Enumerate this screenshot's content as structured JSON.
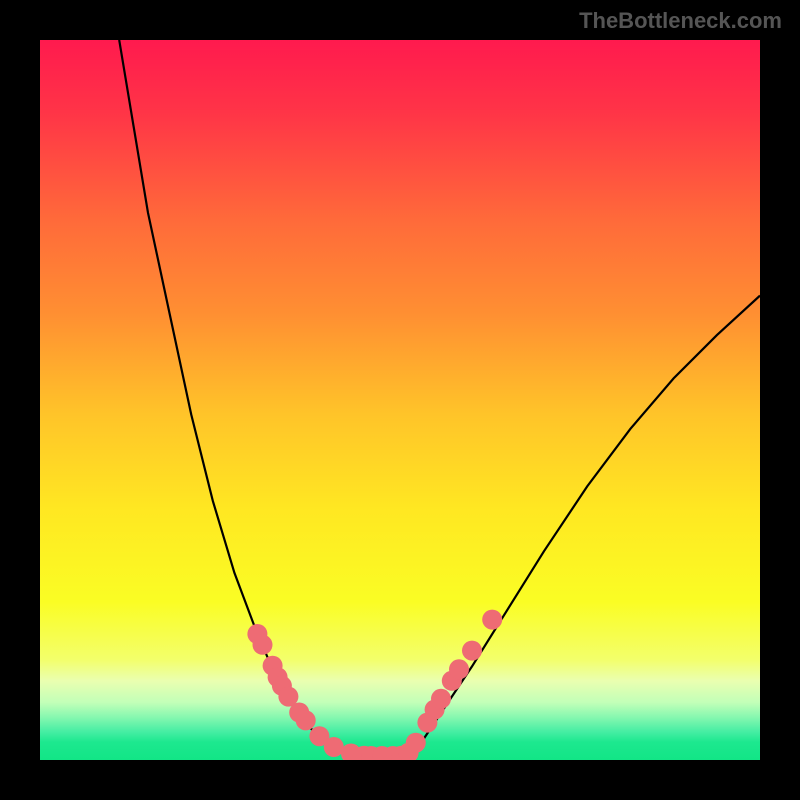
{
  "watermark": "TheBottleneck.com",
  "chart_data": {
    "type": "line",
    "title": "",
    "xlabel": "",
    "ylabel": "",
    "xlim": [
      0,
      100
    ],
    "ylim": [
      0,
      100
    ],
    "gradient_stops": [
      {
        "pos": 0.0,
        "color": "#ff1a4e"
      },
      {
        "pos": 0.1,
        "color": "#ff3447"
      },
      {
        "pos": 0.25,
        "color": "#ff6a3a"
      },
      {
        "pos": 0.38,
        "color": "#ff8f32"
      },
      {
        "pos": 0.52,
        "color": "#ffc429"
      },
      {
        "pos": 0.65,
        "color": "#ffe722"
      },
      {
        "pos": 0.78,
        "color": "#fafd24"
      },
      {
        "pos": 0.86,
        "color": "#f3ff6a"
      },
      {
        "pos": 0.89,
        "color": "#eaffb0"
      },
      {
        "pos": 0.92,
        "color": "#c2ffb8"
      },
      {
        "pos": 0.94,
        "color": "#88f8b0"
      },
      {
        "pos": 0.96,
        "color": "#48eea4"
      },
      {
        "pos": 0.975,
        "color": "#1de88f"
      },
      {
        "pos": 1.0,
        "color": "#12e586"
      }
    ],
    "curve_left": [
      {
        "x": 11.0,
        "y": 100.0
      },
      {
        "x": 13.0,
        "y": 88.0
      },
      {
        "x": 15.0,
        "y": 76.0
      },
      {
        "x": 18.0,
        "y": 62.0
      },
      {
        "x": 21.0,
        "y": 48.0
      },
      {
        "x": 24.0,
        "y": 36.0
      },
      {
        "x": 27.0,
        "y": 26.0
      },
      {
        "x": 30.0,
        "y": 18.0
      },
      {
        "x": 33.0,
        "y": 11.0
      },
      {
        "x": 36.0,
        "y": 6.0
      },
      {
        "x": 39.0,
        "y": 3.0
      },
      {
        "x": 42.0,
        "y": 1.2
      },
      {
        "x": 44.5,
        "y": 0.6
      }
    ],
    "curve_flat": [
      {
        "x": 44.5,
        "y": 0.6
      },
      {
        "x": 47.0,
        "y": 0.55
      },
      {
        "x": 49.0,
        "y": 0.55
      },
      {
        "x": 51.0,
        "y": 0.6
      }
    ],
    "curve_right": [
      {
        "x": 51.0,
        "y": 0.6
      },
      {
        "x": 53.0,
        "y": 2.5
      },
      {
        "x": 56.0,
        "y": 7.0
      },
      {
        "x": 60.0,
        "y": 13.0
      },
      {
        "x": 65.0,
        "y": 21.0
      },
      {
        "x": 70.0,
        "y": 29.0
      },
      {
        "x": 76.0,
        "y": 38.0
      },
      {
        "x": 82.0,
        "y": 46.0
      },
      {
        "x": 88.0,
        "y": 53.0
      },
      {
        "x": 94.0,
        "y": 59.0
      },
      {
        "x": 100.0,
        "y": 64.5
      }
    ],
    "markers": [
      {
        "x": 30.2,
        "y": 17.5
      },
      {
        "x": 30.9,
        "y": 16.0
      },
      {
        "x": 32.3,
        "y": 13.1
      },
      {
        "x": 33.0,
        "y": 11.5
      },
      {
        "x": 33.6,
        "y": 10.3
      },
      {
        "x": 34.5,
        "y": 8.8
      },
      {
        "x": 36.0,
        "y": 6.6
      },
      {
        "x": 36.9,
        "y": 5.5
      },
      {
        "x": 38.8,
        "y": 3.3
      },
      {
        "x": 40.8,
        "y": 1.8
      },
      {
        "x": 43.2,
        "y": 0.9
      },
      {
        "x": 45.0,
        "y": 0.6
      },
      {
        "x": 46.0,
        "y": 0.55
      },
      {
        "x": 47.5,
        "y": 0.55
      },
      {
        "x": 49.0,
        "y": 0.55
      },
      {
        "x": 50.2,
        "y": 0.6
      },
      {
        "x": 51.2,
        "y": 1.0
      },
      {
        "x": 52.2,
        "y": 2.4
      },
      {
        "x": 53.8,
        "y": 5.2
      },
      {
        "x": 54.8,
        "y": 7.0
      },
      {
        "x": 55.7,
        "y": 8.5
      },
      {
        "x": 57.2,
        "y": 11.0
      },
      {
        "x": 58.2,
        "y": 12.6
      },
      {
        "x": 60.0,
        "y": 15.2
      },
      {
        "x": 62.8,
        "y": 19.5
      }
    ],
    "marker_color": "#ee6b74",
    "marker_radius_px": 10
  }
}
